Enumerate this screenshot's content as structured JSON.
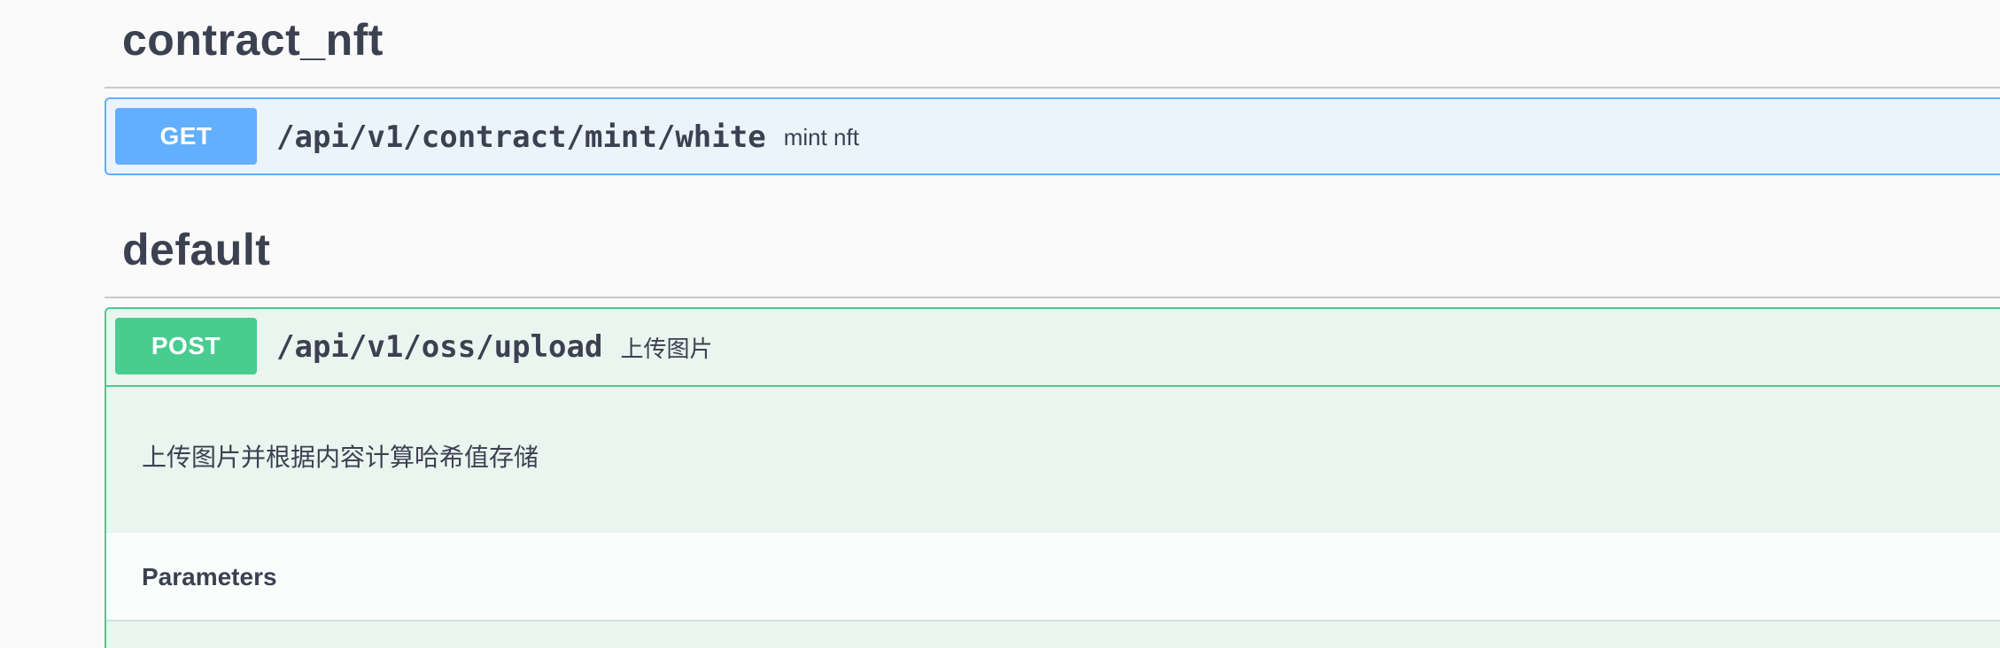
{
  "sections": [
    {
      "title": "contract_nft",
      "operations": [
        {
          "method": "GET",
          "path": "/api/v1/contract/mint/white",
          "summary": "mint nft",
          "color": "#61affe"
        }
      ]
    },
    {
      "title": "default",
      "operations": [
        {
          "method": "POST",
          "path": "/api/v1/oss/upload",
          "summary": "上传图片",
          "description": "上传图片并根据内容计算哈希值存储",
          "parameters_label": "Parameters",
          "color": "#49cc90"
        }
      ]
    }
  ]
}
